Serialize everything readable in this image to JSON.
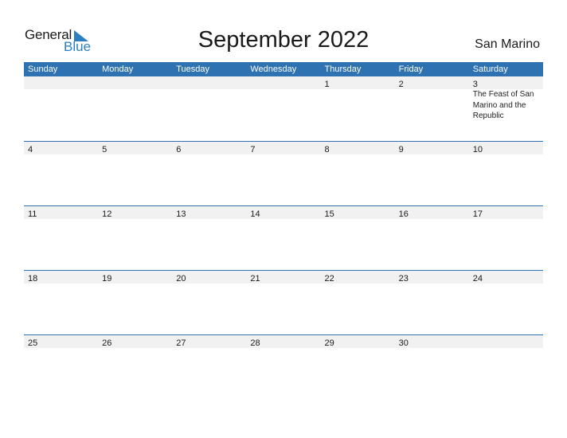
{
  "logo": {
    "word1": "General",
    "word2": "Blue"
  },
  "header": {
    "title": "September 2022",
    "country": "San Marino"
  },
  "colors": {
    "accent": "#2e72b2",
    "row_bg": "#f1f1f1",
    "logo_blue": "#2a7fc1"
  },
  "weekdays": [
    "Sunday",
    "Monday",
    "Tuesday",
    "Wednesday",
    "Thursday",
    "Friday",
    "Saturday"
  ],
  "weeks": [
    {
      "days": [
        "",
        "",
        "",
        "",
        "1",
        "2",
        "3"
      ],
      "events": [
        "",
        "",
        "",
        "",
        "",
        "",
        "The Feast of San Marino and the Republic"
      ]
    },
    {
      "days": [
        "4",
        "5",
        "6",
        "7",
        "8",
        "9",
        "10"
      ],
      "events": [
        "",
        "",
        "",
        "",
        "",
        "",
        ""
      ]
    },
    {
      "days": [
        "11",
        "12",
        "13",
        "14",
        "15",
        "16",
        "17"
      ],
      "events": [
        "",
        "",
        "",
        "",
        "",
        "",
        ""
      ]
    },
    {
      "days": [
        "18",
        "19",
        "20",
        "21",
        "22",
        "23",
        "24"
      ],
      "events": [
        "",
        "",
        "",
        "",
        "",
        "",
        ""
      ]
    },
    {
      "days": [
        "25",
        "26",
        "27",
        "28",
        "29",
        "30",
        ""
      ],
      "events": [
        "",
        "",
        "",
        "",
        "",
        "",
        ""
      ]
    }
  ]
}
